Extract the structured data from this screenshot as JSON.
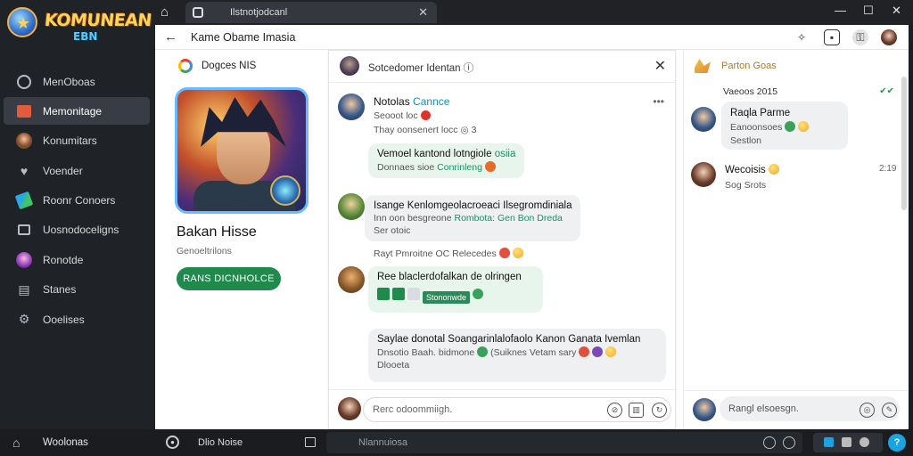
{
  "app": {
    "logo_title": "KOMUNEAN",
    "logo_subtitle": "EBN"
  },
  "sidebar": {
    "items": [
      {
        "label": "MenOboas",
        "icon": "circle-icon"
      },
      {
        "label": "Memonitage",
        "icon": "red-square-icon",
        "active": true
      },
      {
        "label": "Konumitars",
        "icon": "avatar-icon"
      },
      {
        "label": "Voender",
        "icon": "heart-icon"
      },
      {
        "label": "Roonr Conoers",
        "icon": "pen-icon"
      },
      {
        "label": "Uosnodoceligns",
        "icon": "square-icon"
      },
      {
        "label": "Ronotde",
        "icon": "avatar-icon"
      },
      {
        "label": "Stanes",
        "icon": "stats-icon"
      },
      {
        "label": "Ooelises",
        "icon": "gear-icon"
      }
    ]
  },
  "browser": {
    "tab_title": "Ilstnotjodcanl",
    "page_title": "Kame Obame Imasia"
  },
  "profile": {
    "header": "Dogces NIS",
    "name": "Bakan Hisse",
    "subtitle": "Genoeltrilons",
    "button": "RANS DICNHOLCE"
  },
  "chat": {
    "title": "Sotcedomer Identan",
    "more": "•••",
    "messages": [
      {
        "name": "Notolas",
        "tag": "Cannce",
        "line1": "Seooot loc",
        "line2": "Thay oonsenert locc",
        "bubble_title": "Vemoel kantond lotngiole",
        "bubble_link": "osiia",
        "bubble_sub": "Donnaes sioe",
        "bubble_sub_link": "Conrinleng"
      },
      {
        "bubble_title": "Isange Kenlomgeolacroeaci Ilsegromdiniala",
        "bubble_sub": "Inn oon besgreone",
        "bubble_sub_link": "Rombota: Gen Bon Dreda",
        "bubble_sub2": "Ser otoic",
        "after": "Rayt Pmroitne OC Relecedes"
      },
      {
        "bubble_title": "Ree blaclerdofalkan de olringen",
        "pill": "Stononwde"
      },
      {
        "bubble_title": "Saylae donotal Soangarinlalofaolo Kanon Ganata Ivemlan",
        "bubble_sub": "Dnsotio Baah. bidmone",
        "bubble_sub_tail": "(Suiknes Vetam sary",
        "bubble_sub2": "Dlooeta"
      }
    ],
    "composer_placeholder": "Rerc odoommiigh."
  },
  "right_panel": {
    "header": "Parton Goas",
    "date": "Vaeoos 2015",
    "check": "✔✔",
    "contacts": [
      {
        "name": "Raqla Parme",
        "sub": "Eanoonsoes"
      },
      {
        "name": "Wecoisis",
        "sub": "Sog Srots",
        "time": "2:19"
      }
    ],
    "sub_tail": "Sestlon",
    "composer_placeholder": "Rangl elsoesgn."
  },
  "taskbar": {
    "label": "Woolonas",
    "mode": "Dlio Noise",
    "search_placeholder": "Nlannuiosa",
    "help": "?"
  },
  "colors": {
    "sidebar_bg": "#1f2227",
    "accent_green": "#1f8a4c",
    "bubble_green": "#e8f5ec",
    "bubble_gray": "#eef0f2"
  }
}
